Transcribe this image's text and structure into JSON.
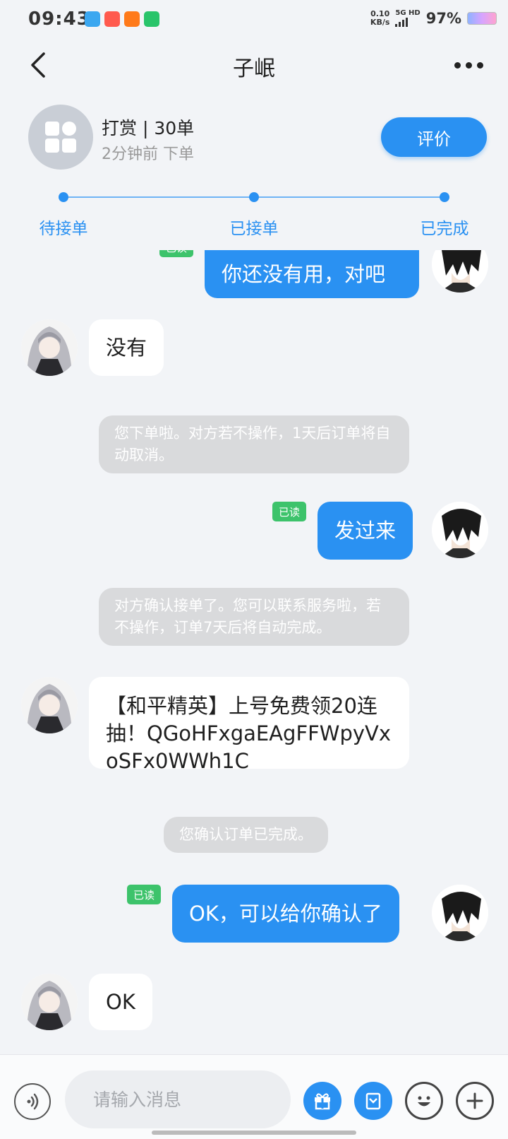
{
  "status_bar": {
    "time": "09:43",
    "speed_value": "0.10",
    "speed_unit": "KB/s",
    "network": "5G HD",
    "battery": "97%"
  },
  "header": {
    "title": "子岷",
    "back_icon": "chevron-left-icon",
    "more_icon": "more-dots-icon"
  },
  "order": {
    "title": "打赏 | 30单",
    "subtitle": "2分钟前 下单",
    "rate_button": "评价",
    "steps": [
      "待接单",
      "已接单",
      "已完成"
    ],
    "accent": "#2a91f2"
  },
  "chat": {
    "read_label": "已读",
    "messages": [
      {
        "type": "out",
        "text": "你还没有用，对吧",
        "read": true
      },
      {
        "type": "in",
        "text": "没有"
      },
      {
        "type": "system",
        "text": "您下单啦。对方若不操作，1天后订单将自动取消。"
      },
      {
        "type": "out",
        "text": "发过来",
        "read": true
      },
      {
        "type": "system",
        "text": "对方确认接单了。您可以联系服务啦，若不操作，订单7天后将自动完成。"
      },
      {
        "type": "in",
        "text": "【和平精英】上号免费领20连抽！QGoHFxgaEAgFFWpyVxoSFx0WWh1C"
      },
      {
        "type": "system",
        "text": "您确认订单已完成。"
      },
      {
        "type": "out",
        "text": "OK，可以给你确认了",
        "read": true
      },
      {
        "type": "in",
        "text": "OK"
      }
    ]
  },
  "input_bar": {
    "placeholder": "请输入消息",
    "icons": [
      "voice-icon",
      "gift-icon",
      "order-icon",
      "emoji-icon",
      "plus-icon"
    ]
  }
}
